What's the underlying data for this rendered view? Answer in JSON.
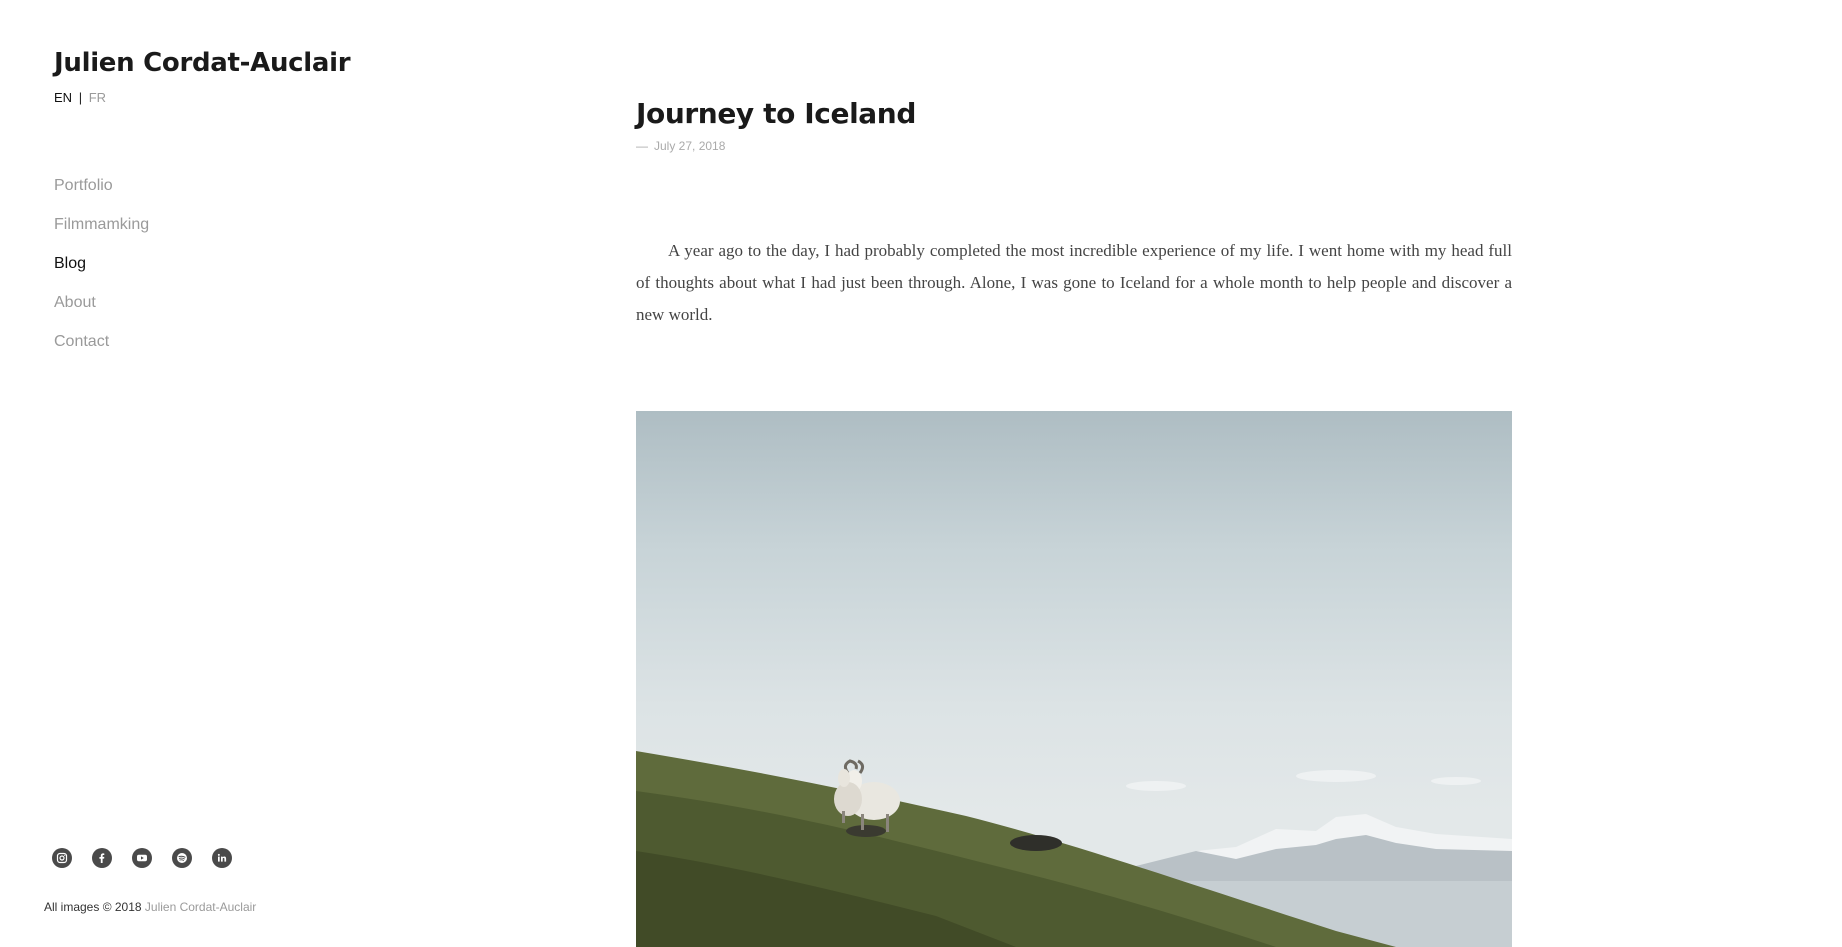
{
  "site": {
    "title": "Julien Cordat-Auclair",
    "languages": {
      "active": "EN",
      "separator": "|",
      "inactive": "FR"
    }
  },
  "nav": {
    "items": [
      {
        "label": "Portfolio",
        "active": false
      },
      {
        "label": "Filmmamking",
        "active": false
      },
      {
        "label": "Blog",
        "active": true
      },
      {
        "label": "About",
        "active": false
      },
      {
        "label": "Contact",
        "active": false
      }
    ]
  },
  "social": {
    "icons": [
      "instagram-icon",
      "facebook-icon",
      "youtube-icon",
      "spotify-icon",
      "linkedin-icon"
    ]
  },
  "footer": {
    "prefix": "All images © 2018",
    "author": "Julien Cordat-Auclair"
  },
  "post": {
    "title": "Journey to Iceland",
    "date_dash": "—",
    "date": "July 27, 2018",
    "body": "A year ago to the day, I had probably completed the most incredible experience of my life. I went home with my head full of thoughts about what I had just been through. Alone, I was gone to Iceland for a whole month to help people and discover a new world."
  },
  "colors": {
    "active_text": "#111111",
    "muted_text": "#9a9a9a",
    "icon_bg": "#4a4a4a",
    "sky": "#dce3e5",
    "grass": "#5e6a3a"
  }
}
